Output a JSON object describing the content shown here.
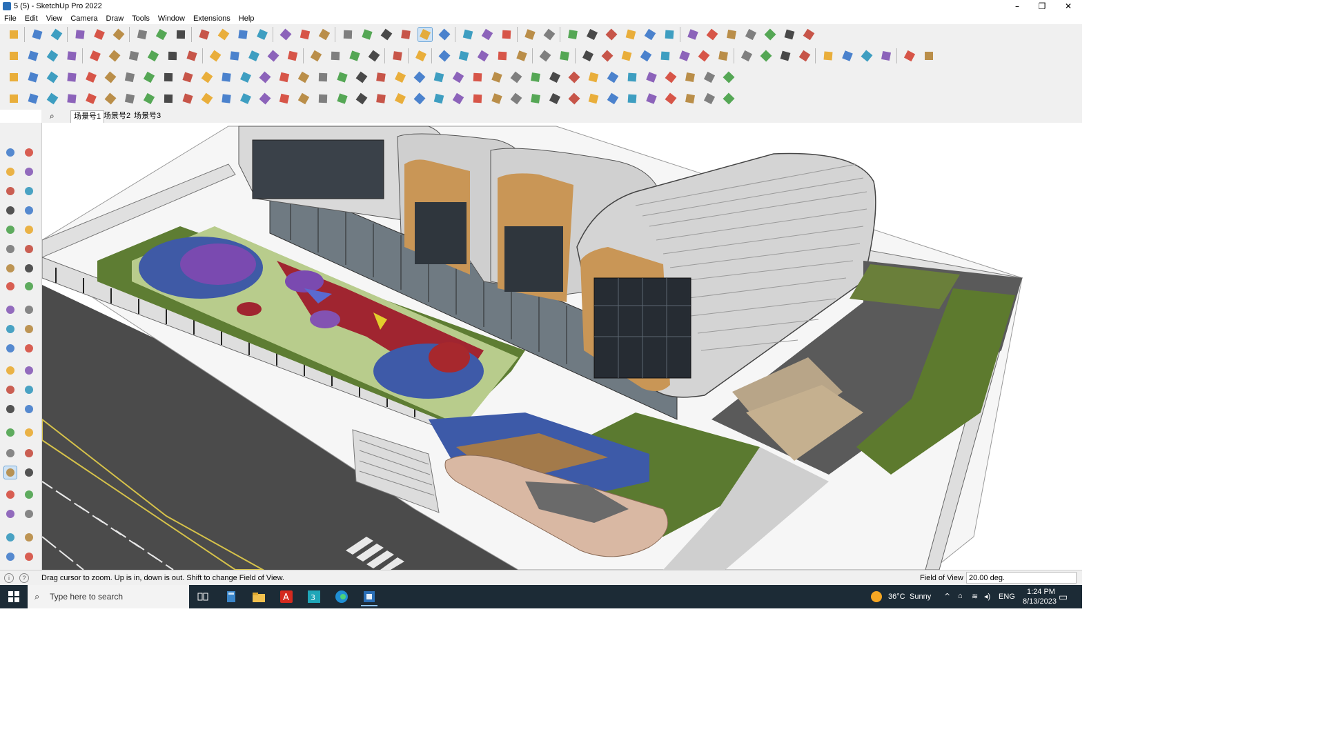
{
  "window": {
    "title": "5 (5) - SketchUp Pro 2022",
    "minimize_glyph": "–",
    "restore_glyph": "❐",
    "close_glyph": "✕"
  },
  "menu": [
    "File",
    "Edit",
    "View",
    "Camera",
    "Draw",
    "Tools",
    "Window",
    "Extensions",
    "Help"
  ],
  "scene_tabs": [
    "场景号1",
    "场景号2",
    "场景号3"
  ],
  "active_scene_tab": 0,
  "statusbar": {
    "message": "Drag cursor to zoom.  Up is in, down is out. Shift to change Field of View.",
    "measurement_label": "Field of View",
    "measurement_value": "20.00 deg."
  },
  "taskbar": {
    "search_placeholder": "Type here to search",
    "weather_temp": "36°C",
    "weather_text": "Sunny",
    "language": "ENG",
    "time": "1:24 PM",
    "date": "8/13/2023"
  },
  "colors": {
    "chrome": "#f0f0f0",
    "taskbar": "#1c2b36",
    "selection": "#cfe3f5",
    "grass": "#5d7a2e",
    "road": "#4a4a4a",
    "court_red": "#a32430",
    "court_green": "#b5c98a",
    "court_blue": "#3e5aa8",
    "court_purple": "#8358b8",
    "wood": "#c89555",
    "roof": "#d7d7d7",
    "paving": "#b8a588",
    "plaza": "#d9b8a3"
  },
  "icons": {
    "app": "sketchup-icon",
    "scene_search": "search-icon",
    "status": [
      "info-icon",
      "help-icon"
    ],
    "taskbar_apps": [
      "task-view-icon",
      "calculator-icon",
      "file-explorer-icon",
      "acrobat-icon",
      "3ds-max-icon",
      "edge-icon",
      "sketchup-icon"
    ]
  }
}
